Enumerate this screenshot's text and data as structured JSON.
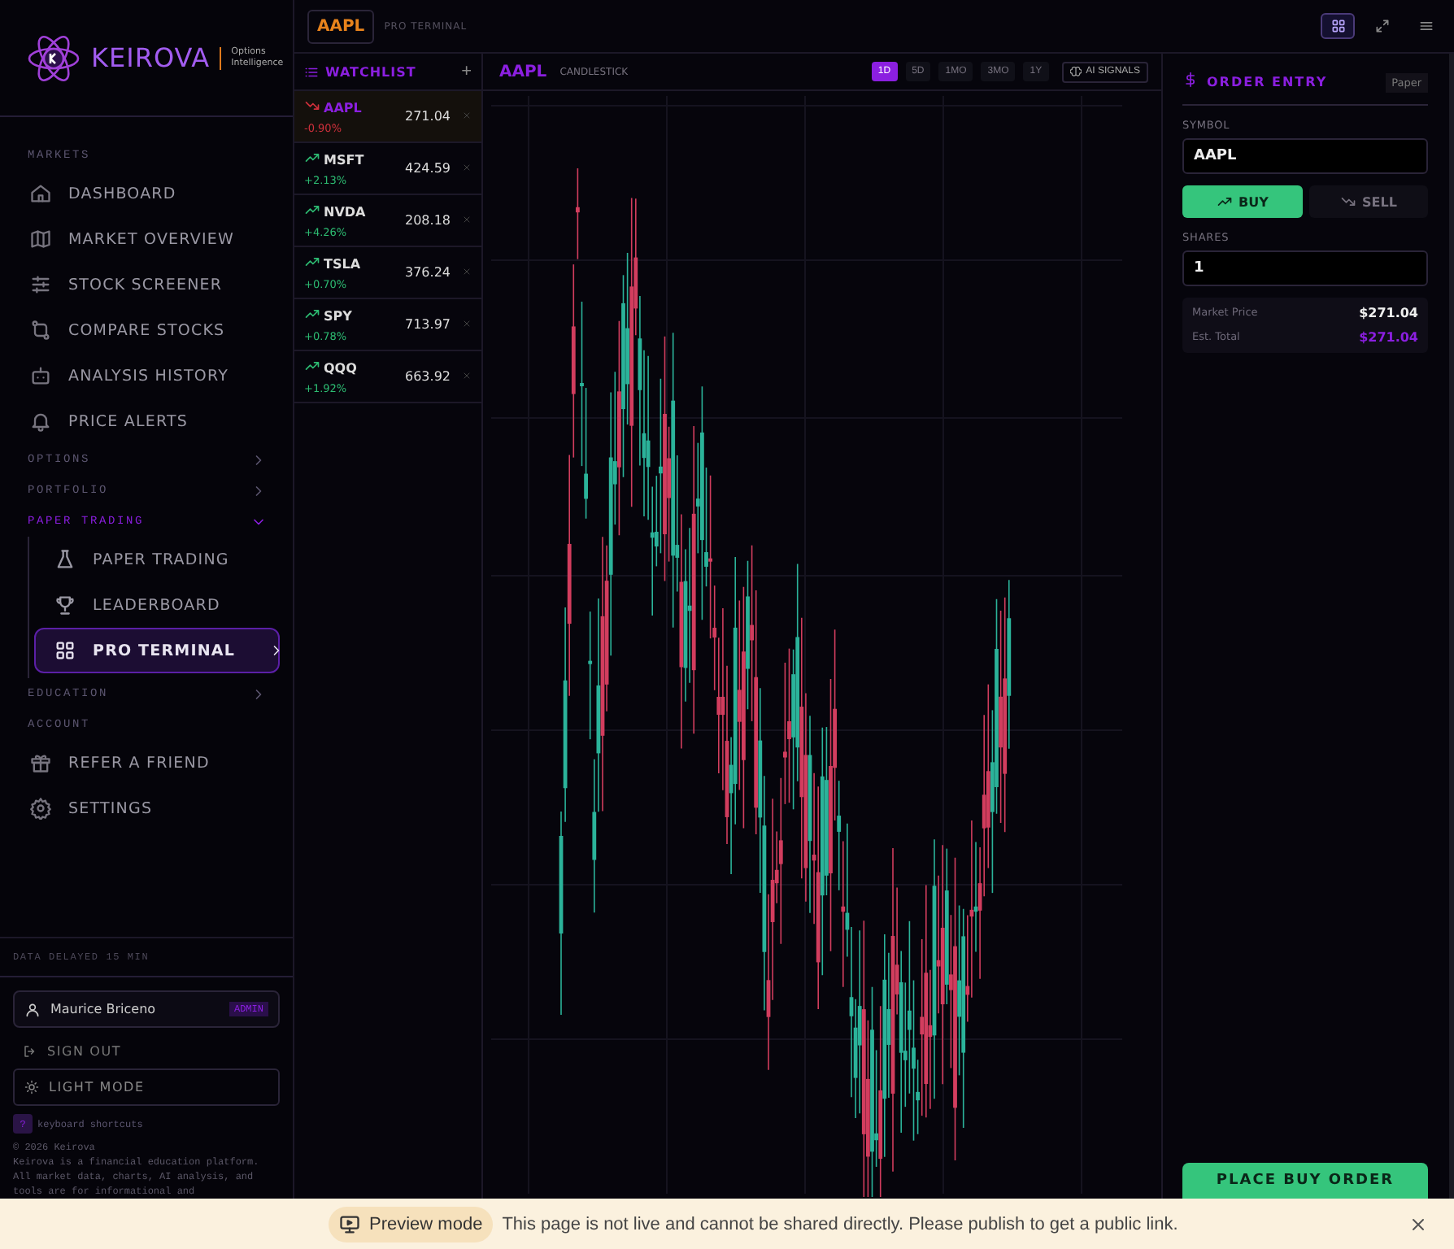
{
  "sidebar": {
    "brand": {
      "name": "KEIROVA",
      "tagline": "Options Intelligence"
    },
    "nav": [
      {
        "kind": "heading",
        "label": "MARKETS"
      },
      {
        "kind": "item",
        "label": "DASHBOARD",
        "selected": false
      },
      {
        "kind": "item",
        "label": "MARKET OVERVIEW",
        "selected": false
      },
      {
        "kind": "item",
        "label": "STOCK SCREENER",
        "selected": false
      },
      {
        "kind": "item",
        "label": "COMPARE STOCKS",
        "selected": false
      },
      {
        "kind": "item",
        "label": "ANALYSIS HISTORY",
        "selected": false
      },
      {
        "kind": "item",
        "label": "PRICE ALERTS",
        "selected": false
      },
      {
        "kind": "group",
        "label": "OPTIONS",
        "expanded": false
      },
      {
        "kind": "group",
        "label": "PORTFOLIO",
        "expanded": false
      },
      {
        "kind": "group",
        "label": "PAPER TRADING",
        "expanded": true,
        "children": [
          {
            "label": "PAPER TRADING",
            "selected": false
          },
          {
            "label": "LEADERBOARD",
            "selected": false
          },
          {
            "label": "PRO TERMINAL",
            "selected": true
          }
        ]
      },
      {
        "kind": "group",
        "label": "EDUCATION",
        "expanded": false
      },
      {
        "kind": "heading",
        "label": "ACCOUNT"
      },
      {
        "kind": "item",
        "label": "REFER A FRIEND",
        "selected": false
      },
      {
        "kind": "item",
        "label": "SETTINGS",
        "selected": false
      }
    ],
    "data_note": "DATA DELAYED 15 MIN",
    "user": {
      "name": "Maurice Briceno",
      "role": "ADMIN"
    },
    "sign_out": "SIGN OUT",
    "theme_button": "LIGHT MODE",
    "shortcuts": {
      "key": "?",
      "label": "keyboard shortcuts"
    },
    "copyright": "© 2026 Keirova",
    "disclaimer": "Keirova is a financial education platform. All market data, charts, AI analysis, and tools are for informational and"
  },
  "topbar": {
    "ticker": "AAPL",
    "title": "PRO TERMINAL",
    "tools": [
      {
        "selected": true
      },
      {
        "selected": false
      },
      {
        "selected": false
      }
    ]
  },
  "watchlist": {
    "title": "WATCHLIST",
    "add": "+",
    "items": [
      {
        "symbol": "AAPL",
        "change": "-0.90%",
        "price": "271.04",
        "rising": false,
        "selected": true
      },
      {
        "symbol": "MSFT",
        "change": "+2.13%",
        "price": "424.59",
        "rising": true,
        "selected": false
      },
      {
        "symbol": "NVDA",
        "change": "+4.26%",
        "price": "208.18",
        "rising": true,
        "selected": false
      },
      {
        "symbol": "TSLA",
        "change": "+0.70%",
        "price": "376.24",
        "rising": true,
        "selected": false
      },
      {
        "symbol": "SPY",
        "change": "+0.78%",
        "price": "713.97",
        "rising": true,
        "selected": false
      },
      {
        "symbol": "QQQ",
        "change": "+1.92%",
        "price": "663.92",
        "rising": true,
        "selected": false
      }
    ]
  },
  "chart": {
    "symbol": "AAPL",
    "type": "CANDLESTICK",
    "ranges": [
      {
        "label": "1D",
        "selected": true
      },
      {
        "label": "5D",
        "selected": false
      },
      {
        "label": "1MO",
        "selected": false
      },
      {
        "label": "3MO",
        "selected": false
      },
      {
        "label": "1Y",
        "selected": false
      }
    ],
    "signals_button": "AI SIGNALS"
  },
  "order": {
    "title": "ORDER ENTRY",
    "badge": "Paper",
    "symbol_label": "SYMBOL",
    "symbol": "AAPL",
    "sides": [
      {
        "label": "BUY",
        "selected": true
      },
      {
        "label": "SELL",
        "selected": false
      }
    ],
    "shares_label": "SHARES",
    "shares": "1",
    "summary": [
      {
        "label": "Market Price",
        "value": "$271.04",
        "kind": "plain"
      },
      {
        "label": "Est. Total",
        "value": "$271.04",
        "kind": "accent"
      }
    ],
    "submit": "PLACE BUY ORDER"
  },
  "banner": {
    "badge": "Preview mode",
    "message": "This page is not live and cannot be shared directly. Please publish to get a public link."
  }
}
